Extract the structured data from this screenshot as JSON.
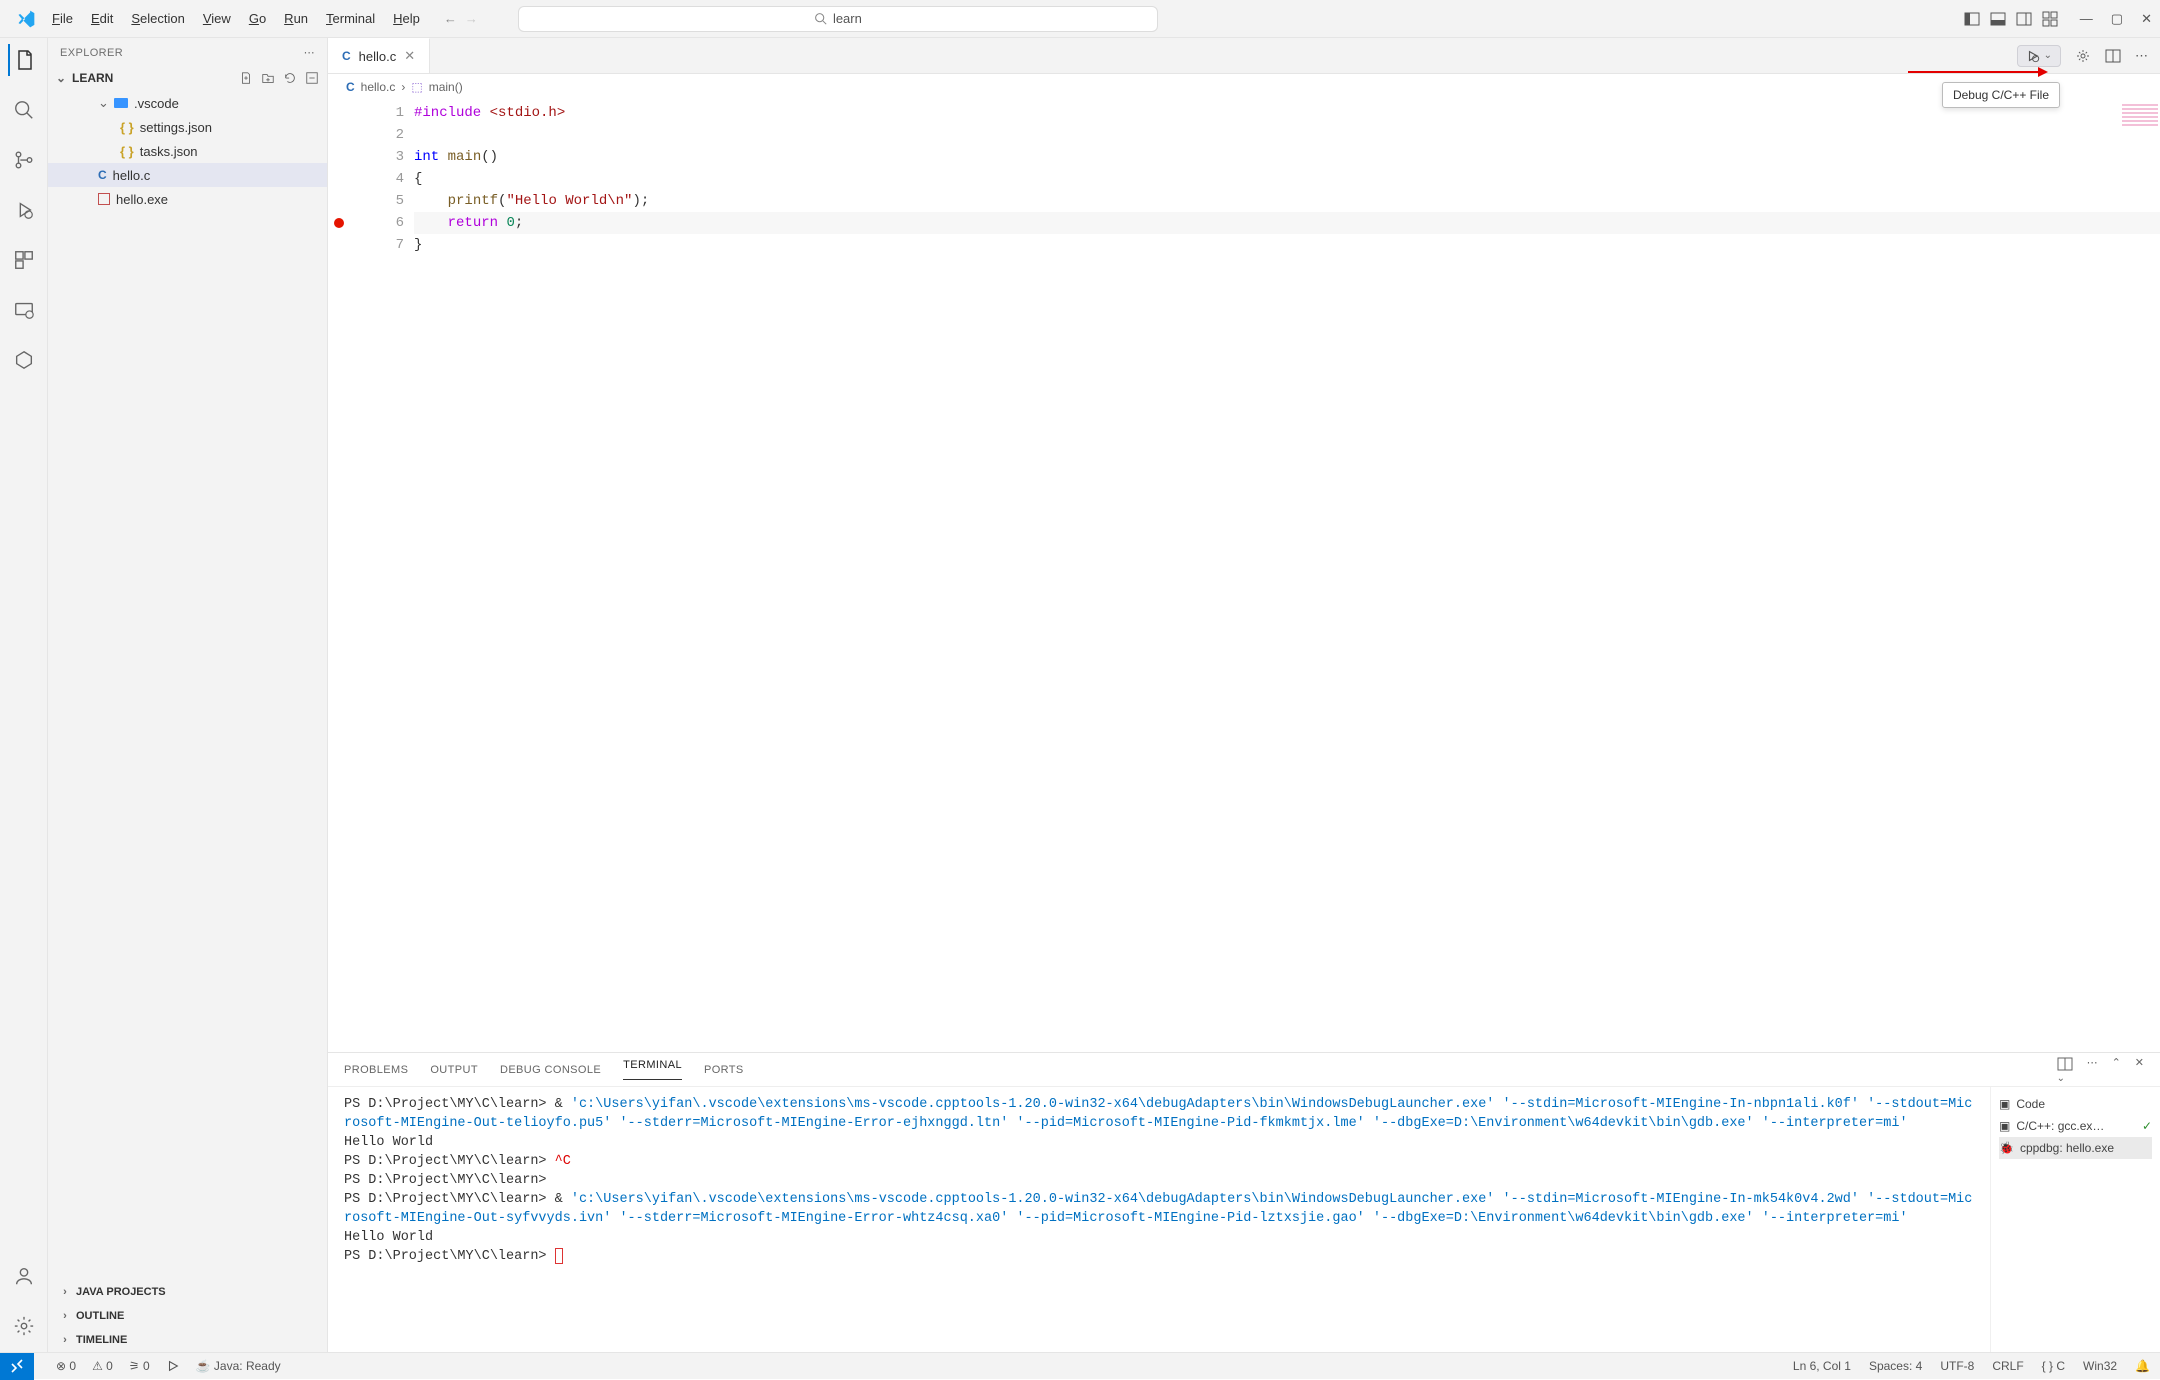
{
  "menu": [
    "File",
    "Edit",
    "Selection",
    "View",
    "Go",
    "Run",
    "Terminal",
    "Help"
  ],
  "search": {
    "placeholder": "learn"
  },
  "explorer": {
    "title": "EXPLORER",
    "project": "LEARN",
    "tree": {
      "vscode_folder": ".vscode",
      "settings": "settings.json",
      "tasks": "tasks.json",
      "helloc": "hello.c",
      "helloexe": "hello.exe"
    },
    "outline_sections": [
      "JAVA PROJECTS",
      "OUTLINE",
      "TIMELINE"
    ]
  },
  "tab": {
    "label": "hello.c"
  },
  "breadcrumbs": {
    "file": "hello.c",
    "symbol": "main()"
  },
  "code": {
    "l1": {
      "pp": "#include ",
      "inc": "<stdio.h>"
    },
    "l3": {
      "t": "int",
      "sp": " ",
      "fn": "main",
      "rest": "()"
    },
    "l4": "{",
    "l5": {
      "ind": "    ",
      "fn": "printf",
      "open": "(",
      "str": "\"Hello World\\n\"",
      "close": ");"
    },
    "l6": {
      "ind": "    ",
      "kw": "return",
      "sp": " ",
      "num": "0",
      "semi": ";"
    },
    "l7": "}"
  },
  "run_tooltip": "Debug C/C++ File",
  "panel": {
    "tabs": [
      "PROBLEMS",
      "OUTPUT",
      "DEBUG CONSOLE",
      "TERMINAL",
      "PORTS"
    ],
    "side": [
      {
        "icon": "term",
        "label": "Code"
      },
      {
        "icon": "term",
        "label": "C/C++: gcc.ex…",
        "check": true
      },
      {
        "icon": "bug",
        "label": "cppdbg: hello.exe",
        "selected": true
      }
    ],
    "terminal": {
      "prompt": "PS D:\\Project\\MY\\C\\learn>",
      "amp": " & ",
      "cmd1": "'c:\\Users\\yifan\\.vscode\\extensions\\ms-vscode.cpptools-1.20.0-win32-x64\\debugAdapters\\bin\\WindowsDebugLauncher.exe' '--stdin=Microsoft-MIEngine-In-nbpn1ali.k0f' '--stdout=Microsoft-MIEngine-Out-telioyfo.pu5' '--stderr=Microsoft-MIEngine-Error-ejhxnggd.ltn' '--pid=Microsoft-MIEngine-Pid-fkmkmtjx.lme' '--dbgExe=D:\\Environment\\w64devkit\\bin\\gdb.exe' '--interpreter=mi'",
      "hello": "Hello World",
      "ctrlc": "^C",
      "cmd2": "'c:\\Users\\yifan\\.vscode\\extensions\\ms-vscode.cpptools-1.20.0-win32-x64\\debugAdapters\\bin\\WindowsDebugLauncher.exe' '--stdin=Microsoft-MIEngine-In-mk54k0v4.2wd' '--stdout=Microsoft-MIEngine-Out-syfvvyds.ivn' '--stderr=Microsoft-MIEngine-Error-whtz4csq.xa0' '--pid=Microsoft-MIEngine-Pid-lztxsjie.gao' '--dbgExe=D:\\Environment\\w64devkit\\bin\\gdb.exe' '--interpreter=mi'"
    }
  },
  "status": {
    "errors": "0",
    "warnings": "0",
    "ports": "0",
    "java": "Java: Ready",
    "ln": "Ln 6, Col 1",
    "spaces": "Spaces: 4",
    "encoding": "UTF-8",
    "eol": "CRLF",
    "lang": "{ }  C",
    "platform": "Win32"
  }
}
